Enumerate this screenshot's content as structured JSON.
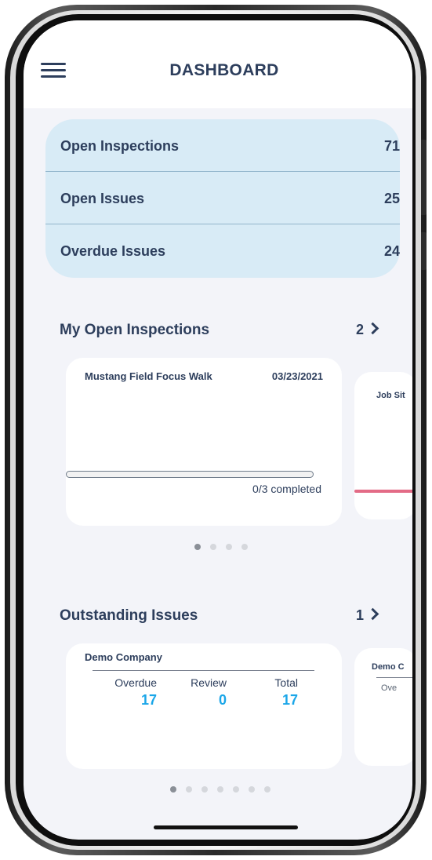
{
  "header": {
    "title": "DASHBOARD",
    "menu_icon": "hamburger-menu-icon"
  },
  "stats": [
    {
      "label": "Open Inspections",
      "value": "71"
    },
    {
      "label": "Open Issues",
      "value": "25"
    },
    {
      "label": "Overdue Issues",
      "value": "24"
    }
  ],
  "my_open_inspections": {
    "title": "My Open Inspections",
    "count": "2",
    "cards": [
      {
        "title": "Mustang Field Focus Walk",
        "date": "03/23/2021",
        "progress_fraction": 0.0,
        "completed_text": "0/3 completed"
      }
    ],
    "peek_title": "Job Sit",
    "page_count": 4,
    "active_page": 0
  },
  "outstanding_issues": {
    "title": "Outstanding Issues",
    "count": "1",
    "cards": [
      {
        "company": "Demo Company",
        "overdue_label": "Overdue",
        "overdue": "17",
        "review_label": "Review",
        "review": "0",
        "total_label": "Total",
        "total": "17"
      }
    ],
    "peek_company": "Demo C",
    "peek_sub": "Ove",
    "page_count": 7,
    "active_page": 0
  },
  "colors": {
    "primary_text": "#2d3e5c",
    "accent_blue": "#1aa6e8",
    "stats_bg": "#d8ebf6",
    "progress_pink": "#e36b86",
    "screen_bg": "#f3f4f9"
  }
}
